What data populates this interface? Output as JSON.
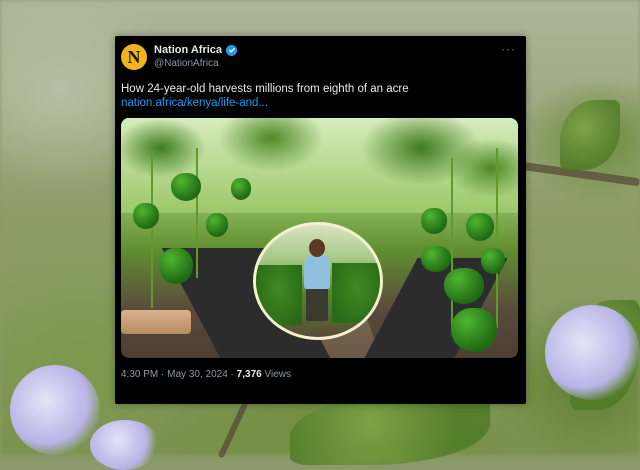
{
  "account": {
    "avatar_letter": "N",
    "display_name": "Nation Africa",
    "handle": "@NationAfrica",
    "verified": true,
    "avatar_color": "#f2b418"
  },
  "tweet": {
    "text": "How 24-year-old harvests millions from eighth of an acre",
    "link": "nation.africa/kenya/life-and...",
    "more_label": "···"
  },
  "meta": {
    "time": "4:30 PM",
    "separator": "·",
    "date": "May 30, 2024",
    "views_count": "7,376",
    "views_label": "Views"
  },
  "colors": {
    "link": "#1d9bf0",
    "card_bg": "#000000",
    "muted": "#8b98a5"
  },
  "icons": [
    "verified-badge-icon",
    "more-options-icon"
  ]
}
